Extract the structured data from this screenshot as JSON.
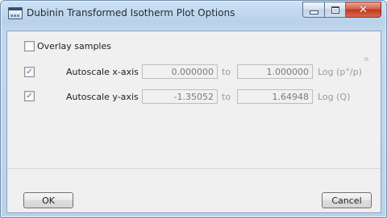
{
  "window": {
    "title": "Dubinin Transformed Isotherm Plot Options",
    "icon": "chart-window-icon"
  },
  "overlay": {
    "label": "Overlay samples",
    "checked": false
  },
  "x_axis": {
    "label": "Autoscale x-axis",
    "checked": true,
    "min": "0.000000",
    "to": "to",
    "max": "1.000000",
    "unit": "Log (p°/p)",
    "unit_sup": "n"
  },
  "y_axis": {
    "label": "Autoscale y-axis",
    "checked": true,
    "min": "-1.35052",
    "to": "to",
    "max": "1.64948",
    "unit": "Log (Q)"
  },
  "buttons": {
    "ok": "OK",
    "cancel": "Cancel"
  },
  "colors": {
    "titlebar": "#c4d8ee",
    "close": "#c2371e",
    "check": "#3c6fb5"
  }
}
